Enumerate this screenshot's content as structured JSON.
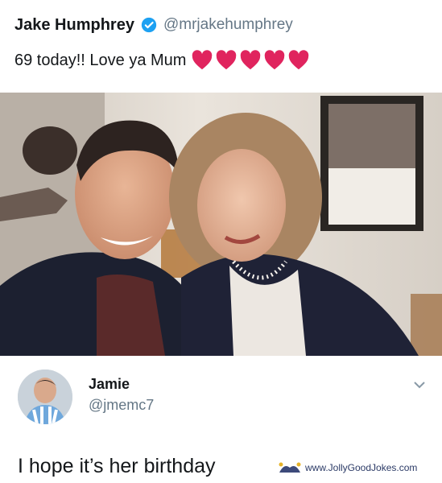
{
  "tweet": {
    "author_name": "Jake Humphrey",
    "author_handle": "@mrjakehumphrey",
    "text": "69 today!! Love ya Mum",
    "heart_count": 5,
    "heart_color": "#e0245e",
    "verified_color": "#1da1f2"
  },
  "reply": {
    "author_name": "Jamie",
    "author_handle": "@jmemc7",
    "text": "I hope it’s her birthday"
  },
  "watermark": {
    "text": "www.JollyGoodJokes.com"
  },
  "icons": {
    "verified": "verified-check-icon",
    "heart": "red-heart-icon",
    "chevron": "chevron-down-icon",
    "watermark": "jester-hat-icon"
  }
}
